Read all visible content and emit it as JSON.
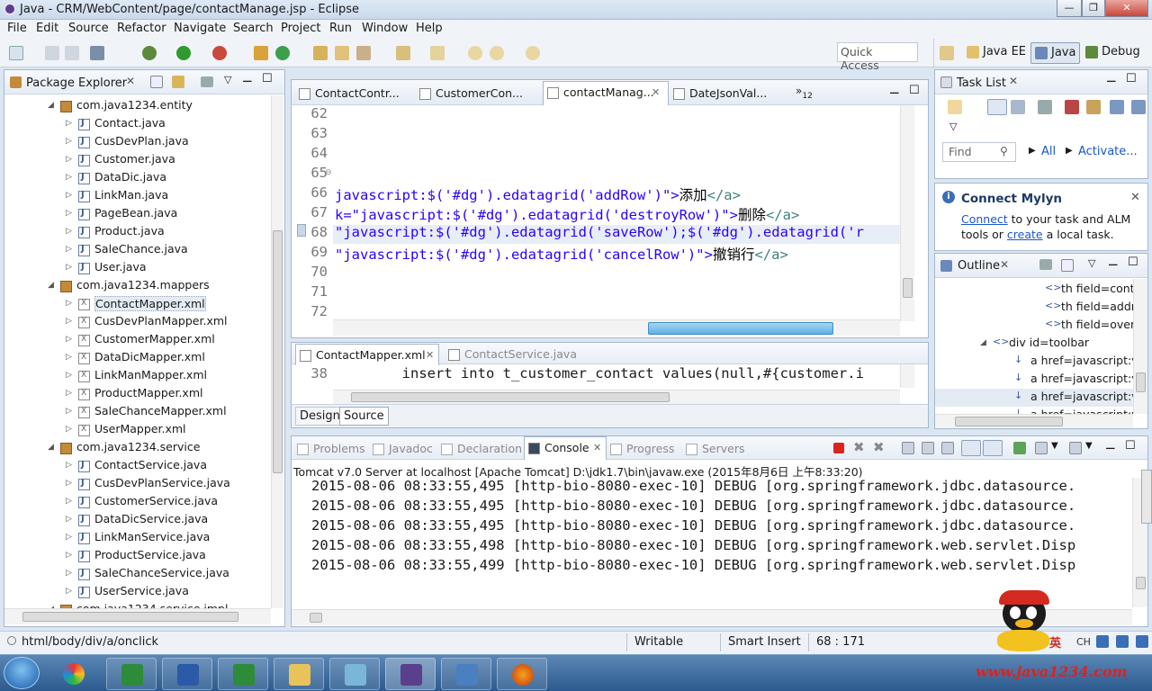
{
  "window": {
    "title": "Java - CRM/WebContent/page/contactManage.jsp - Eclipse"
  },
  "menu": [
    "File",
    "Edit",
    "Source",
    "Refactor",
    "Navigate",
    "Search",
    "Project",
    "Run",
    "Window",
    "Help"
  ],
  "toolbar": {
    "quick_access_placeholder": "Quick Access"
  },
  "perspectives": [
    "Java EE",
    "Java",
    "Debug"
  ],
  "package_explorer": {
    "title": "Package Explorer",
    "rows": [
      {
        "label": "com.java1234.entity",
        "type": "package",
        "indent": 0,
        "expanded": true
      },
      {
        "label": "Contact.java",
        "type": "java",
        "indent": 1
      },
      {
        "label": "CusDevPlan.java",
        "type": "java",
        "indent": 1
      },
      {
        "label": "Customer.java",
        "type": "java",
        "indent": 1
      },
      {
        "label": "DataDic.java",
        "type": "java",
        "indent": 1
      },
      {
        "label": "LinkMan.java",
        "type": "java",
        "indent": 1
      },
      {
        "label": "PageBean.java",
        "type": "java",
        "indent": 1
      },
      {
        "label": "Product.java",
        "type": "java",
        "indent": 1
      },
      {
        "label": "SaleChance.java",
        "type": "java",
        "indent": 1
      },
      {
        "label": "User.java",
        "type": "java",
        "indent": 1
      },
      {
        "label": "com.java1234.mappers",
        "type": "package",
        "indent": 0,
        "expanded": true
      },
      {
        "label": "ContactMapper.xml",
        "type": "xml",
        "indent": 1,
        "selected": true
      },
      {
        "label": "CusDevPlanMapper.xml",
        "type": "xml",
        "indent": 1
      },
      {
        "label": "CustomerMapper.xml",
        "type": "xml",
        "indent": 1
      },
      {
        "label": "DataDicMapper.xml",
        "type": "xml",
        "indent": 1
      },
      {
        "label": "LinkManMapper.xml",
        "type": "xml",
        "indent": 1
      },
      {
        "label": "ProductMapper.xml",
        "type": "xml",
        "indent": 1
      },
      {
        "label": "SaleChanceMapper.xml",
        "type": "xml",
        "indent": 1
      },
      {
        "label": "UserMapper.xml",
        "type": "xml",
        "indent": 1
      },
      {
        "label": "com.java1234.service",
        "type": "package",
        "indent": 0,
        "expanded": true
      },
      {
        "label": "ContactService.java",
        "type": "java",
        "indent": 1
      },
      {
        "label": "CusDevPlanService.java",
        "type": "java",
        "indent": 1
      },
      {
        "label": "CustomerService.java",
        "type": "java",
        "indent": 1
      },
      {
        "label": "DataDicService.java",
        "type": "java",
        "indent": 1
      },
      {
        "label": "LinkManService.java",
        "type": "java",
        "indent": 1
      },
      {
        "label": "ProductService.java",
        "type": "java",
        "indent": 1
      },
      {
        "label": "SaleChanceService.java",
        "type": "java",
        "indent": 1
      },
      {
        "label": "UserService.java",
        "type": "java",
        "indent": 1
      },
      {
        "label": "com.java1234.service.impl",
        "type": "package",
        "indent": 0,
        "expanded": true
      }
    ]
  },
  "editor": {
    "tabs": [
      "ContactContr...",
      "CustomerCon...",
      "contactManag...",
      "DateJsonVal..."
    ],
    "active_tab": 2,
    "overflow_count": "12",
    "lines": [
      {
        "num": "62",
        "parts": []
      },
      {
        "num": "63",
        "parts": []
      },
      {
        "num": "64",
        "parts": []
      },
      {
        "num": "65",
        "parts": []
      },
      {
        "num": "66",
        "parts": [
          {
            "t": "javascript:$('#dg').edatagrid('addRow')\">",
            "c": "str"
          },
          {
            "t": "添加",
            "c": "txt"
          },
          {
            "t": "</a>",
            "c": "tagc"
          }
        ]
      },
      {
        "num": "67",
        "parts": [
          {
            "t": "k=\"javascript:$('#dg').edatagrid('destroyRow')\">",
            "c": "str"
          },
          {
            "t": "删除",
            "c": "txt"
          },
          {
            "t": "</a>",
            "c": "tagc"
          }
        ]
      },
      {
        "num": "68",
        "parts": [
          {
            "t": "\"javascript:$('#dg').edatagrid('saveRow');$('#dg').edatagrid('r",
            "c": "str"
          }
        ]
      },
      {
        "num": "69",
        "parts": [
          {
            "t": "\"javascript:$('#dg').edatagrid('cancelRow')\">",
            "c": "str"
          },
          {
            "t": "撤销行",
            "c": "txt"
          },
          {
            "t": "</a>",
            "c": "tagc"
          }
        ]
      },
      {
        "num": "70",
        "parts": []
      },
      {
        "num": "71",
        "parts": []
      },
      {
        "num": "72",
        "parts": []
      }
    ]
  },
  "second_editor": {
    "tabs": [
      "ContactMapper.xml",
      "ContactService.java"
    ],
    "line_num": "38",
    "line_text": "        insert into t_customer_contact values(null,#{customer.i",
    "bottom_tabs": [
      "Design",
      "Source"
    ]
  },
  "task_list": {
    "title": "Task List",
    "find_placeholder": "Find",
    "all": "All",
    "activate": "Activate..."
  },
  "connect_mylyn": {
    "title": "Connect Mylyn",
    "link1": "Connect",
    "text1": " to your task and ALM",
    "text2": "tools or ",
    "link2": "create",
    "text3": " a local task."
  },
  "outline": {
    "title": "Outline",
    "rows": [
      "th field=conta",
      "th field=addr",
      "th field=over",
      "div id=toolbar",
      "a href=javascript:vo",
      "a href=javascript:vo",
      "a href=javascript:vo",
      "a href=javascript:vo"
    ]
  },
  "console": {
    "tabs": [
      "Problems",
      "Javadoc",
      "Declaration",
      "Console",
      "Progress",
      "Servers"
    ],
    "active_tab": 3,
    "server_line": "Tomcat v7.0 Server at localhost [Apache Tomcat] D:\\jdk1.7\\bin\\javaw.exe (2015年8月6日 上午8:33:20)",
    "lines": [
      "2015-08-06 08:33:55,495 [http-bio-8080-exec-10] DEBUG [org.springframework.jdbc.datasource.",
      "2015-08-06 08:33:55,495 [http-bio-8080-exec-10] DEBUG [org.springframework.jdbc.datasource.",
      "2015-08-06 08:33:55,495 [http-bio-8080-exec-10] DEBUG [org.springframework.jdbc.datasource.",
      "2015-08-06 08:33:55,498 [http-bio-8080-exec-10] DEBUG [org.springframework.web.servlet.Disp",
      "2015-08-06 08:33:55,499 [http-bio-8080-exec-10] DEBUG [org.springframework.web.servlet.Disp"
    ]
  },
  "statusbar": {
    "path": "html/body/div/a/onclick",
    "writable": "Writable",
    "insert": "Smart Insert",
    "position": "68 : 171"
  },
  "tray": {
    "ime": "英",
    "ch": "CH"
  },
  "watermark": "www.java1234.com",
  "colors": {
    "string": "#2a00ff",
    "tag": "#3f7f7f",
    "link": "#1a56c9",
    "taskbar": "#2c5a8e"
  }
}
